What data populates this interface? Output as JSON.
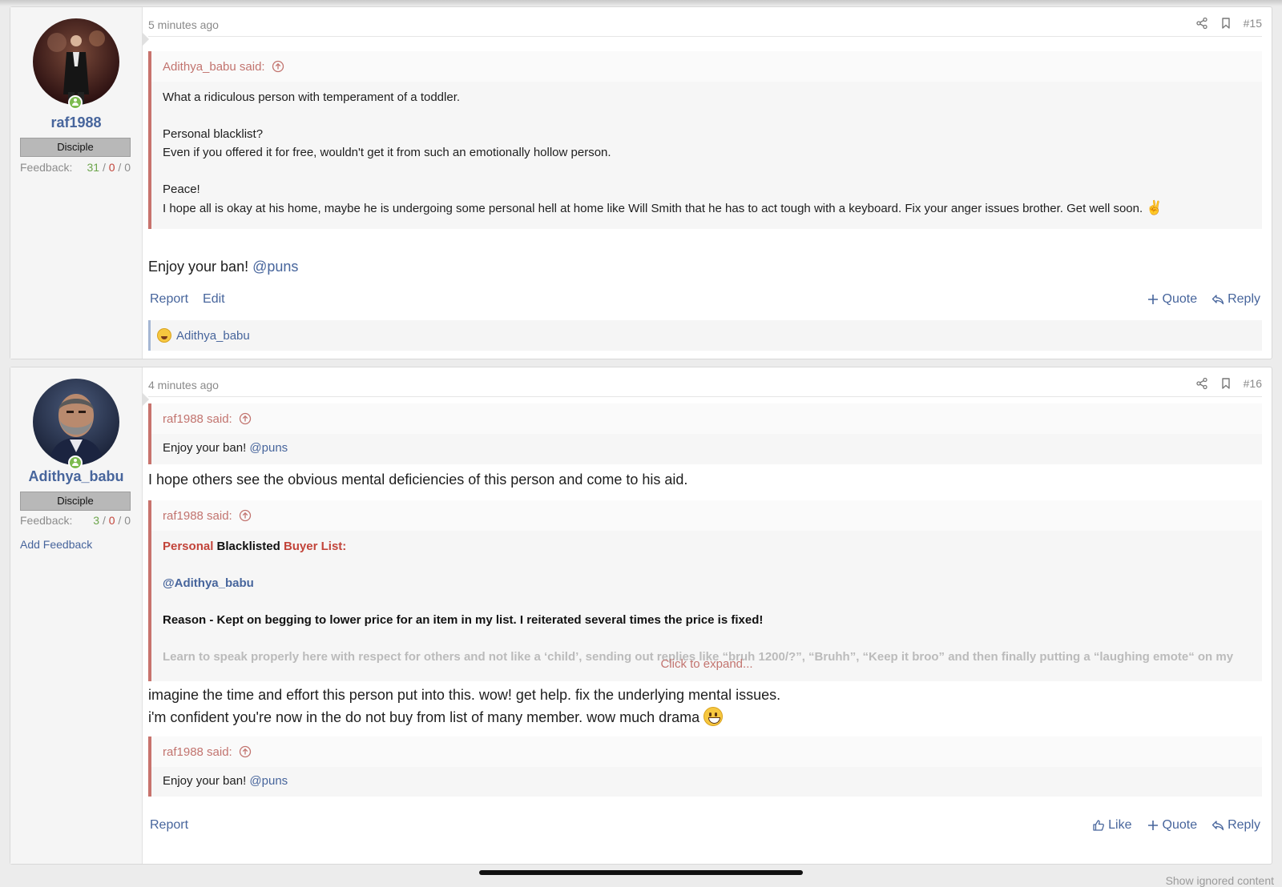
{
  "posts": [
    {
      "number": "#15",
      "time": "5 minutes ago",
      "author": {
        "name": "raf1988",
        "rank": "Disciple",
        "feedback_label": "Feedback:",
        "feedback_positive": "31",
        "feedback_negative": "0",
        "feedback_neutral": "0",
        "online": true
      },
      "quote": {
        "author_said": "Adithya_babu said:",
        "lines": [
          "What a ridiculous person with temperament of a toddler.",
          "Personal blacklist?",
          "Even if you offered it for free, wouldn't get it from such an emotionally hollow person.",
          "Peace!",
          "I hope all is okay at his home, maybe he is undergoing some personal hell at home like Will Smith that he has to act tough with a keyboard. Fix your anger issues brother. Get well soon."
        ],
        "trailing_emoji": "✌"
      },
      "message": {
        "text": "Enjoy your ban!",
        "mention": "@puns"
      },
      "actions_left": [
        "Report",
        "Edit"
      ],
      "actions_right": [
        "Quote",
        "Reply"
      ],
      "reactions": {
        "user": "Adithya_babu"
      }
    },
    {
      "number": "#16",
      "time": "4 minutes ago",
      "author": {
        "name": "Adithya_babu",
        "rank": "Disciple",
        "feedback_label": "Feedback:",
        "feedback_positive": "3",
        "feedback_negative": "0",
        "feedback_neutral": "0",
        "add_feedback": "Add Feedback",
        "online": true
      },
      "quote1": {
        "author_said": "raf1988 said:",
        "text": "Enjoy your ban!",
        "mention": "@puns"
      },
      "message1": "I hope others see the obvious mental deficiencies of this person and come to his aid.",
      "quote2": {
        "author_said": "raf1988 said:",
        "title_part1": "Personal",
        "title_part2": "Blacklisted",
        "title_part3": "Buyer List:",
        "mention": "@Adithya_babu",
        "reason": "Reason - Kept on begging to lower price for an item in my list. I reiterated several times the price is fixed!",
        "faded": "Learn to speak properly here with respect for others and not like a ‘child’, sending out replies like “bruh 1200/?”, “Bruhh”, “Keep it broo” and then finally putting a “laughing emote“ on my",
        "expand": "Click to expand..."
      },
      "message2_line1": "imagine the time and effort this person put into this. wow! get help. fix the underlying mental issues.",
      "message2_line2": "i'm confident you're now in the do not buy from list of many member. wow much drama",
      "quote3": {
        "author_said": "raf1988 said:",
        "text": "Enjoy your ban!",
        "mention": "@puns"
      },
      "actions_left": [
        "Report"
      ],
      "actions_right": [
        "Like",
        "Quote",
        "Reply"
      ]
    }
  ],
  "footer": {
    "show_ignored": "Show ignored content"
  },
  "colors": {
    "accent": "#47659c",
    "quote_border": "#c8736d",
    "online": "#7cbb4f"
  }
}
